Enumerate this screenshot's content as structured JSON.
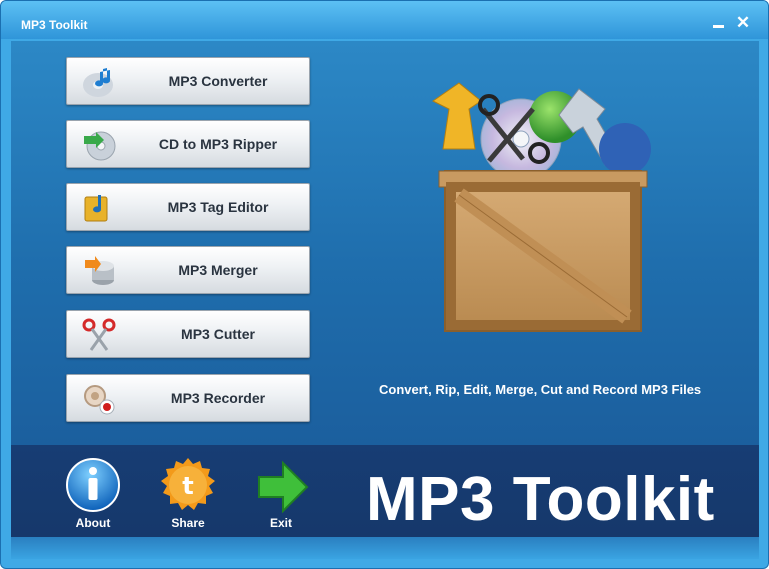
{
  "window": {
    "title": "MP3 Toolkit",
    "minimize_glyph": "",
    "close_glyph": "✕"
  },
  "menu": [
    {
      "label": "MP3 Converter",
      "icon": "music-note-icon"
    },
    {
      "label": "CD to MP3 Ripper",
      "icon": "cd-rip-icon"
    },
    {
      "label": "MP3 Tag Editor",
      "icon": "tag-editor-icon"
    },
    {
      "label": "MP3 Merger",
      "icon": "merger-icon"
    },
    {
      "label": "MP3 Cutter",
      "icon": "scissors-icon"
    },
    {
      "label": "MP3 Recorder",
      "icon": "recorder-icon"
    }
  ],
  "tagline": "Convert, Rip, Edit, Merge, Cut and Record MP3 Files",
  "footer": {
    "about_label": "About",
    "share_label": "Share",
    "exit_label": "Exit",
    "brand": "MP3 Toolkit"
  },
  "colors": {
    "accent": "#3fa9e6",
    "footer": "#16386b",
    "button_text": "#2a3440"
  }
}
